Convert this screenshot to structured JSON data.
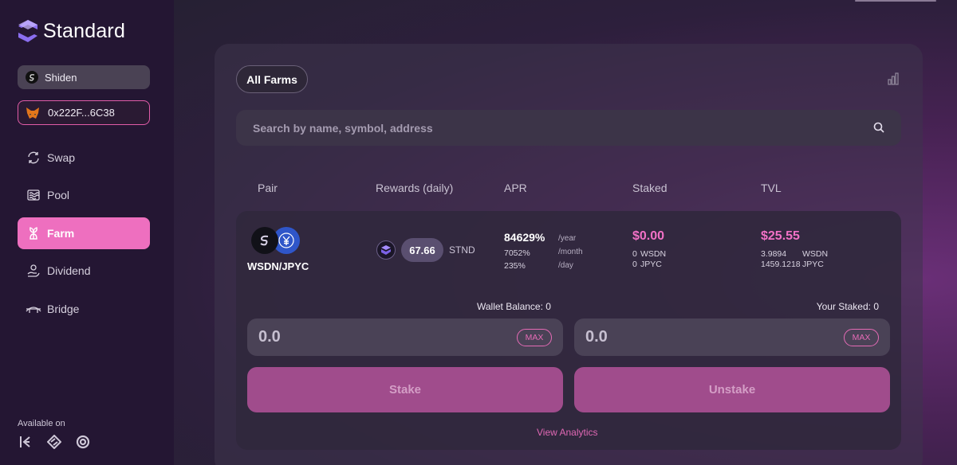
{
  "app": {
    "name": "Standard"
  },
  "network": {
    "label": "Shiden"
  },
  "wallet": {
    "address": "0x222F...6C38"
  },
  "nav": {
    "items": [
      {
        "label": "Swap",
        "icon": "swap-icon"
      },
      {
        "label": "Pool",
        "icon": "pool-icon"
      },
      {
        "label": "Farm",
        "icon": "farm-icon",
        "active": true
      },
      {
        "label": "Dividend",
        "icon": "dividend-icon"
      },
      {
        "label": "Bridge",
        "icon": "bridge-icon"
      }
    ]
  },
  "footer": {
    "available_label": "Available on"
  },
  "farms": {
    "filter_label": "All Farms",
    "search_placeholder": "Search by name, symbol, address",
    "columns": [
      "Pair",
      "Rewards (daily)",
      "APR",
      "Staked",
      "TVL"
    ],
    "row": {
      "pair": "WSDN/JPYC",
      "reward_amount": "67.66",
      "reward_symbol": "STND",
      "apr_year": "84629%",
      "apr_year_unit": "/year",
      "apr_month": "7052%",
      "apr_month_unit": "/month",
      "apr_day": "235%",
      "apr_day_unit": "/day",
      "staked_usd": "$0.00",
      "staked_a": "0",
      "staked_a_sym": "WSDN",
      "staked_b": "0",
      "staked_b_sym": "JPYC",
      "tvl_usd": "$25.55",
      "tvl_a": "3.9894",
      "tvl_a_sym": "WSDN",
      "tvl_b": "1459.1218",
      "tvl_b_sym": "JPYC",
      "wallet_balance": "Wallet Balance: 0",
      "your_staked": "Your Staked: 0",
      "stake_value": "0.0",
      "unstake_value": "0.0",
      "max_label": "MAX",
      "stake_label": "Stake",
      "unstake_label": "Unstake",
      "analytics_label": "View Analytics"
    }
  },
  "colors": {
    "accent": "#ee6fbf",
    "pink_text": "#f271c6",
    "sidebar": "#241633"
  }
}
